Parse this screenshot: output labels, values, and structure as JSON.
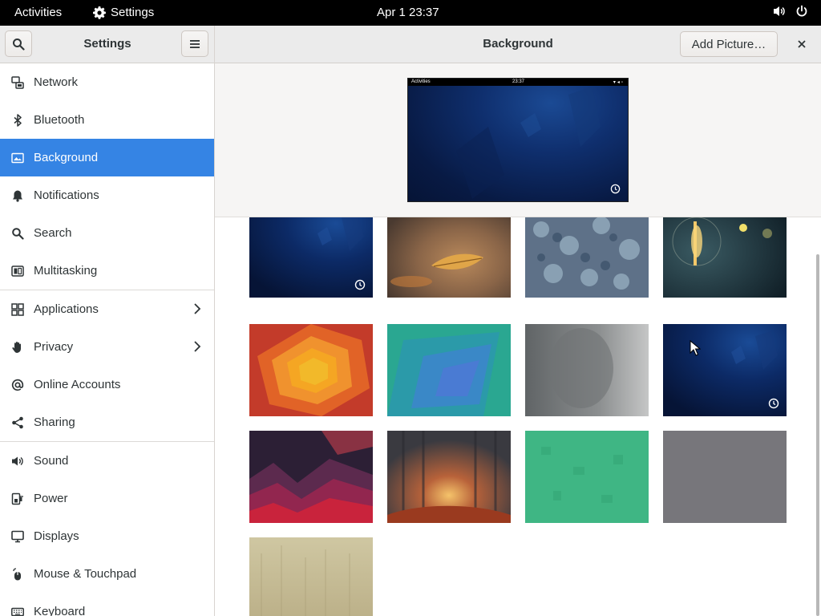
{
  "topbar": {
    "activities": "Activities",
    "app_name": "Settings",
    "clock": "Apr 1  23:37",
    "icons": [
      "gear-icon",
      "volume-icon",
      "power-icon"
    ]
  },
  "sidebar": {
    "title": "Settings",
    "items": [
      {
        "label": "Network",
        "icon": "network-icon"
      },
      {
        "label": "Bluetooth",
        "icon": "bluetooth-icon"
      },
      {
        "label": "Background",
        "icon": "background-icon",
        "active": true
      },
      {
        "label": "Notifications",
        "icon": "bell-icon"
      },
      {
        "label": "Search",
        "icon": "search-icon"
      },
      {
        "label": "Multitasking",
        "icon": "multitasking-icon"
      },
      {
        "label": "Applications",
        "icon": "applications-icon",
        "has_chevron": true
      },
      {
        "label": "Privacy",
        "icon": "hand-icon",
        "has_chevron": true
      },
      {
        "label": "Online Accounts",
        "icon": "at-icon"
      },
      {
        "label": "Sharing",
        "icon": "share-icon"
      },
      {
        "label": "Sound",
        "icon": "speaker-icon"
      },
      {
        "label": "Power",
        "icon": "power-plug-icon"
      },
      {
        "label": "Displays",
        "icon": "display-icon"
      },
      {
        "label": "Mouse & Touchpad",
        "icon": "mouse-icon"
      },
      {
        "label": "Keyboard",
        "icon": "keyboard-icon"
      }
    ]
  },
  "main": {
    "title": "Background",
    "add_picture_label": "Add Picture…",
    "preview": {
      "topbar_activities": "Activities",
      "topbar_clock": "23:37"
    }
  },
  "colors": {
    "accent": "#3584e4",
    "header_bg": "#ebebeb",
    "text": "#2e3436"
  }
}
